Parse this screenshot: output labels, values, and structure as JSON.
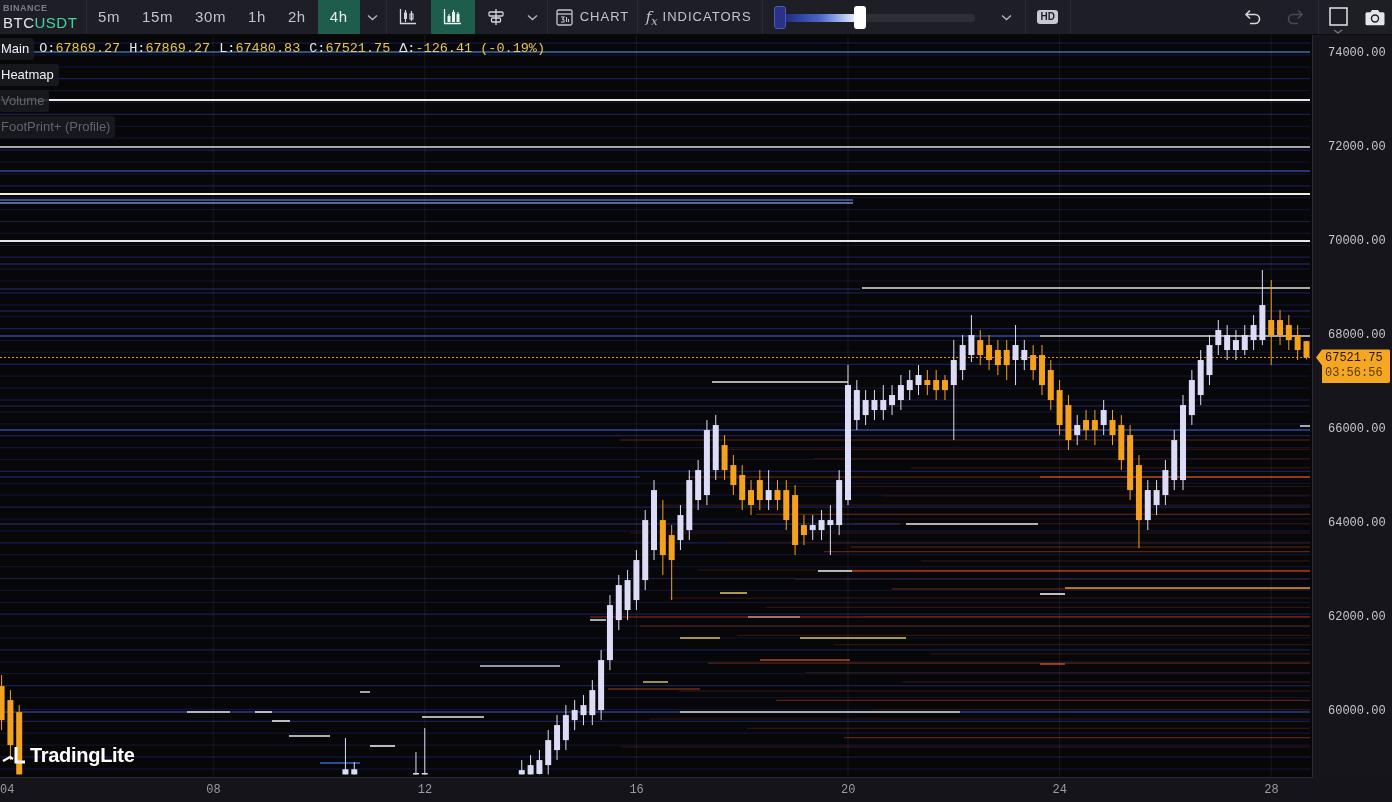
{
  "toolbar": {
    "exchange": "BINANCE",
    "symbol": {
      "base": "BTC",
      "quote": "USDT"
    },
    "timeframes": [
      {
        "label": "5m",
        "selected": false
      },
      {
        "label": "15m",
        "selected": false
      },
      {
        "label": "30m",
        "selected": false
      },
      {
        "label": "1h",
        "selected": false
      },
      {
        "label": "2h",
        "selected": false
      },
      {
        "label": "4h",
        "selected": true
      }
    ],
    "chart_styles": [
      {
        "kind": "candles",
        "selected": false
      },
      {
        "kind": "bars",
        "selected": true
      },
      {
        "kind": "profile",
        "selected": false
      }
    ],
    "chart_button": {
      "label": "CHART"
    },
    "indicators_button": {
      "icon": "f$_{x}$",
      "label": "INDICATORS"
    },
    "slider": {
      "level": 0.41
    },
    "hd": {
      "label": "HD"
    },
    "history": [
      {
        "kind": "undo",
        "disabled": false
      },
      {
        "kind": "redo",
        "disabled": true
      }
    ]
  },
  "legend": {
    "layers": [
      {
        "name": "Main",
        "visible": true
      },
      {
        "name": "Heatmap",
        "visible": true
      },
      {
        "name": "Volume",
        "visible": false
      },
      {
        "name": "FootPrint+ (Profile)",
        "visible": false
      }
    ],
    "ohlc": [
      {
        "label": "O:",
        "value": "67869.27"
      },
      {
        "label": "H:",
        "value": "67869.27"
      },
      {
        "label": "L:",
        "value": "67480.83"
      },
      {
        "label": "C:",
        "value": "67521.75"
      },
      {
        "label": "Δ:",
        "value": "-126.41 (-0.19%)"
      }
    ]
  },
  "chart": {
    "chart_data": {
      "type": "candlestick",
      "x": [
        4,
        4.167,
        4.333,
        10.5,
        10.667,
        11.833,
        12,
        13.833,
        14,
        14.167,
        14.333,
        14.5,
        14.667,
        14.833,
        15,
        15.167,
        15.333,
        15.5,
        15.667,
        15.833,
        16,
        16.167,
        16.333,
        16.5,
        16.667,
        16.833,
        17,
        17.167,
        17.333,
        17.5,
        17.667,
        17.833,
        18,
        18.167,
        18.333,
        18.5,
        18.667,
        18.833,
        19,
        19.167,
        19.333,
        19.5,
        19.667,
        19.833,
        20,
        20.167,
        20.333,
        20.5,
        20.667,
        20.833,
        21,
        21.167,
        21.333,
        21.5,
        21.667,
        21.833,
        22,
        22.167,
        22.333,
        22.5,
        22.667,
        22.833,
        23,
        23.167,
        23.333,
        23.5,
        23.667,
        23.833,
        24,
        24.167,
        24.333,
        24.5,
        24.667,
        24.833,
        25,
        25.167,
        25.333,
        25.5,
        25.667,
        25.833,
        26,
        26.167,
        26.333,
        26.5,
        26.667,
        26.833,
        27,
        27.167,
        27.333,
        27.5,
        27.667,
        27.833,
        28,
        28.167,
        28.333,
        28.5,
        28.667
      ],
      "ohlc": [
        [
          60530,
          60764,
          59593,
          59806
        ],
        [
          60232,
          60444,
          58955,
          59274
        ],
        [
          59976,
          60125,
          58650,
          58650
        ],
        [
          58650,
          59423,
          58650,
          58760
        ],
        [
          58650,
          58912,
          58650,
          58760
        ],
        [
          58650,
          59125,
          58650,
          58680
        ],
        [
          58650,
          59636,
          58650,
          58680
        ],
        [
          58650,
          58955,
          58650,
          58742
        ],
        [
          58650,
          59061,
          58650,
          58848
        ],
        [
          58660,
          59168,
          58650,
          58955
        ],
        [
          58848,
          59593,
          58650,
          59380
        ],
        [
          59168,
          59912,
          58955,
          59700
        ],
        [
          59380,
          60125,
          59168,
          59912
        ],
        [
          59806,
          60232,
          59593,
          60019
        ],
        [
          59912,
          60338,
          59700,
          60125
        ],
        [
          59912,
          60657,
          59700,
          60444
        ],
        [
          60019,
          61296,
          59806,
          61083
        ],
        [
          61083,
          62466,
          60870,
          62253
        ],
        [
          61934,
          62892,
          61721,
          62679
        ],
        [
          62147,
          62998,
          61934,
          62785
        ],
        [
          62360,
          63424,
          62147,
          63211
        ],
        [
          62785,
          64275,
          62572,
          64062
        ],
        [
          63424,
          64913,
          63211,
          64700
        ],
        [
          64062,
          64488,
          62892,
          63317
        ],
        [
          63743,
          63956,
          62360,
          63211
        ],
        [
          63636,
          64381,
          63424,
          64168
        ],
        [
          63849,
          65126,
          63636,
          64913
        ],
        [
          64488,
          65339,
          64275,
          65126
        ],
        [
          64594,
          66190,
          64381,
          65977
        ],
        [
          65126,
          66296,
          64913,
          66084
        ],
        [
          65658,
          65871,
          64913,
          65126
        ],
        [
          65232,
          65445,
          64594,
          64807
        ],
        [
          65020,
          65232,
          64275,
          64488
        ],
        [
          64700,
          64913,
          64168,
          64381
        ],
        [
          64913,
          65126,
          64275,
          64488
        ],
        [
          64488,
          65126,
          64275,
          64700
        ],
        [
          64700,
          64913,
          64275,
          64488
        ],
        [
          64700,
          64913,
          63849,
          64062
        ],
        [
          64594,
          64807,
          63317,
          63530
        ],
        [
          63956,
          64168,
          63530,
          63743
        ],
        [
          63849,
          64168,
          63636,
          63956
        ],
        [
          63849,
          64275,
          63636,
          64062
        ],
        [
          63956,
          64381,
          63317,
          64062
        ],
        [
          63956,
          65126,
          63743,
          64913
        ],
        [
          64488,
          67360,
          64381,
          66935
        ],
        [
          66190,
          67041,
          65977,
          66828
        ],
        [
          66296,
          66828,
          66084,
          66616
        ],
        [
          66403,
          66828,
          66190,
          66616
        ],
        [
          66403,
          66935,
          66190,
          66616
        ],
        [
          66509,
          66935,
          66296,
          66722
        ],
        [
          66616,
          67148,
          66403,
          66935
        ],
        [
          66828,
          67254,
          66616,
          67041
        ],
        [
          66935,
          67360,
          66722,
          67148
        ],
        [
          67041,
          67254,
          66722,
          66935
        ],
        [
          67041,
          67254,
          66616,
          66828
        ],
        [
          67041,
          67148,
          66616,
          66828
        ],
        [
          66935,
          67892,
          65764,
          67467
        ],
        [
          67254,
          67999,
          67041,
          67786
        ],
        [
          67573,
          68424,
          67425,
          67999
        ],
        [
          67892,
          68105,
          67360,
          67573
        ],
        [
          67786,
          67999,
          67254,
          67467
        ],
        [
          67680,
          67892,
          67148,
          67360
        ],
        [
          67680,
          67892,
          67041,
          67360
        ],
        [
          67467,
          68212,
          66935,
          67786
        ],
        [
          67467,
          67892,
          67254,
          67680
        ],
        [
          67573,
          67786,
          67041,
          67254
        ],
        [
          67573,
          67786,
          66722,
          66935
        ],
        [
          67254,
          67467,
          66403,
          66616
        ],
        [
          66828,
          67041,
          65871,
          66084
        ],
        [
          66509,
          66722,
          65552,
          65764
        ],
        [
          65871,
          66296,
          65658,
          66084
        ],
        [
          66190,
          66403,
          65764,
          65977
        ],
        [
          66190,
          66403,
          65658,
          65977
        ],
        [
          66084,
          66616,
          65871,
          66403
        ],
        [
          66190,
          66403,
          65658,
          65871
        ],
        [
          66084,
          66296,
          65126,
          65339
        ],
        [
          65871,
          66084,
          64488,
          64700
        ],
        [
          65232,
          65445,
          63466,
          64062
        ],
        [
          64062,
          64913,
          63849,
          64700
        ],
        [
          64381,
          64913,
          64168,
          64700
        ],
        [
          64594,
          65339,
          64381,
          65126
        ],
        [
          64913,
          65977,
          64700,
          65764
        ],
        [
          64913,
          66722,
          64700,
          66509
        ],
        [
          66296,
          67254,
          66084,
          67041
        ],
        [
          66722,
          67680,
          66509,
          67467
        ],
        [
          67148,
          67999,
          66935,
          67786
        ],
        [
          67786,
          68318,
          67573,
          68105
        ],
        [
          67680,
          68212,
          67467,
          67999
        ],
        [
          67680,
          68105,
          67467,
          67892
        ],
        [
          67680,
          68212,
          67573,
          67999
        ],
        [
          67892,
          68424,
          67680,
          68212
        ],
        [
          67892,
          69382,
          67786,
          68637
        ],
        [
          68318,
          69169,
          67360,
          67999
        ],
        [
          68318,
          68531,
          67786,
          67999
        ],
        [
          68212,
          68424,
          67680,
          67892
        ],
        [
          67999,
          68212,
          67467,
          67680
        ],
        [
          67869.27,
          67869.27,
          67480.83,
          67521.75
        ]
      ],
      "xlim": [
        3.97,
        28.79
      ],
      "ylim": [
        58574,
        74383
      ],
      "grid": true,
      "xticks": [
        {
          "value": 4,
          "label": "04"
        },
        {
          "value": 8,
          "label": "08"
        },
        {
          "value": 12,
          "label": "12"
        },
        {
          "value": 16,
          "label": "16"
        },
        {
          "value": 20,
          "label": "20"
        },
        {
          "value": 24,
          "label": "24"
        },
        {
          "value": 28,
          "label": "28"
        }
      ],
      "yticks": [
        {
          "value": 74000,
          "label": "74000.00"
        },
        {
          "value": 72000,
          "label": "72000.00"
        },
        {
          "value": 70000,
          "label": "70000.00"
        },
        {
          "value": 68000,
          "label": "68000.00"
        },
        {
          "value": 66000,
          "label": "66000.00"
        },
        {
          "value": 64000,
          "label": "64000.00"
        },
        {
          "value": 62000,
          "label": "62000.00"
        },
        {
          "value": 60000,
          "label": "60000.00"
        }
      ]
    }
  },
  "price_axis": {
    "current_price": {
      "price": "67521.75",
      "countdown": "03:56:56"
    }
  },
  "logo": {
    "text": "TradingLite"
  }
}
